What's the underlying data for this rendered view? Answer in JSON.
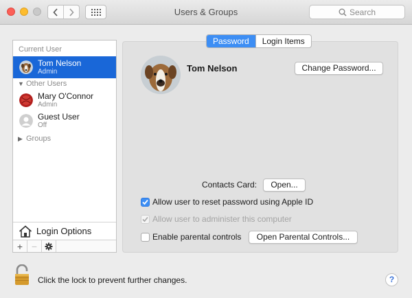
{
  "window": {
    "title": "Users & Groups"
  },
  "search": {
    "placeholder": "Search"
  },
  "sidebar": {
    "current_user_header": "Current User",
    "current_user": {
      "name": "Tom Nelson",
      "role": "Admin"
    },
    "other_users_header": "Other Users",
    "other_users": [
      {
        "name": "Mary O'Connor",
        "role": "Admin"
      },
      {
        "name": "Guest User",
        "role": "Off"
      }
    ],
    "groups_header": "Groups",
    "login_options_label": "Login Options",
    "toolbar": {
      "add": "+",
      "remove": "−"
    }
  },
  "tabs": [
    {
      "label": "Password",
      "active": true
    },
    {
      "label": "Login Items",
      "active": false
    }
  ],
  "main": {
    "user_name": "Tom Nelson",
    "change_password_label": "Change Password...",
    "contacts_card_label": "Contacts Card:",
    "open_button_label": "Open...",
    "options": [
      {
        "label": "Allow user to reset password using Apple ID",
        "checked": true,
        "enabled": true
      },
      {
        "label": "Allow user to administer this computer",
        "checked": true,
        "enabled": false
      },
      {
        "label": "Enable parental controls",
        "checked": false,
        "enabled": true
      }
    ],
    "parental_button_label": "Open Parental Controls..."
  },
  "footer": {
    "lock_text": "Click the lock to prevent further changes.",
    "help": "?"
  },
  "colors": {
    "selection": "#1967d8",
    "accent": "#3d8ef4"
  }
}
